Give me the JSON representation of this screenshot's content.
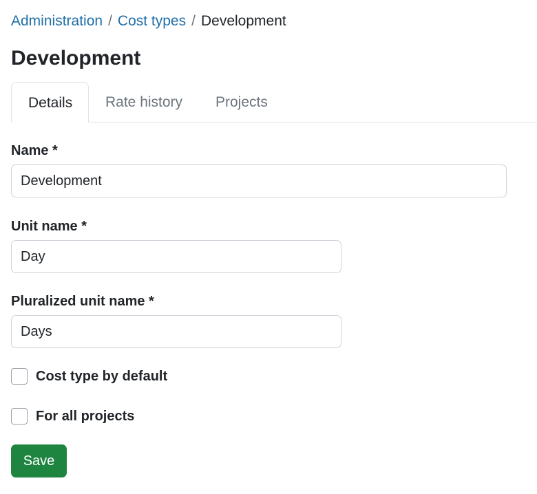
{
  "breadcrumb": {
    "items": [
      "Administration",
      "Cost types"
    ],
    "separator": "/",
    "current": "Development"
  },
  "page": {
    "title": "Development"
  },
  "tabs": [
    {
      "label": "Details",
      "active": true
    },
    {
      "label": "Rate history",
      "active": false
    },
    {
      "label": "Projects",
      "active": false
    }
  ],
  "form": {
    "name": {
      "label": "Name *",
      "value": "Development"
    },
    "unit_name": {
      "label": "Unit name *",
      "value": "Day"
    },
    "pluralized_unit_name": {
      "label": "Pluralized unit name *",
      "value": "Days"
    },
    "cost_type_by_default": {
      "label": "Cost type by default",
      "checked": false
    },
    "for_all_projects": {
      "label": "For all projects",
      "checked": false
    },
    "save_label": "Save"
  },
  "colors": {
    "link": "#1f6fa8",
    "primary_button": "#1e8540",
    "border": "#dee2e6"
  }
}
